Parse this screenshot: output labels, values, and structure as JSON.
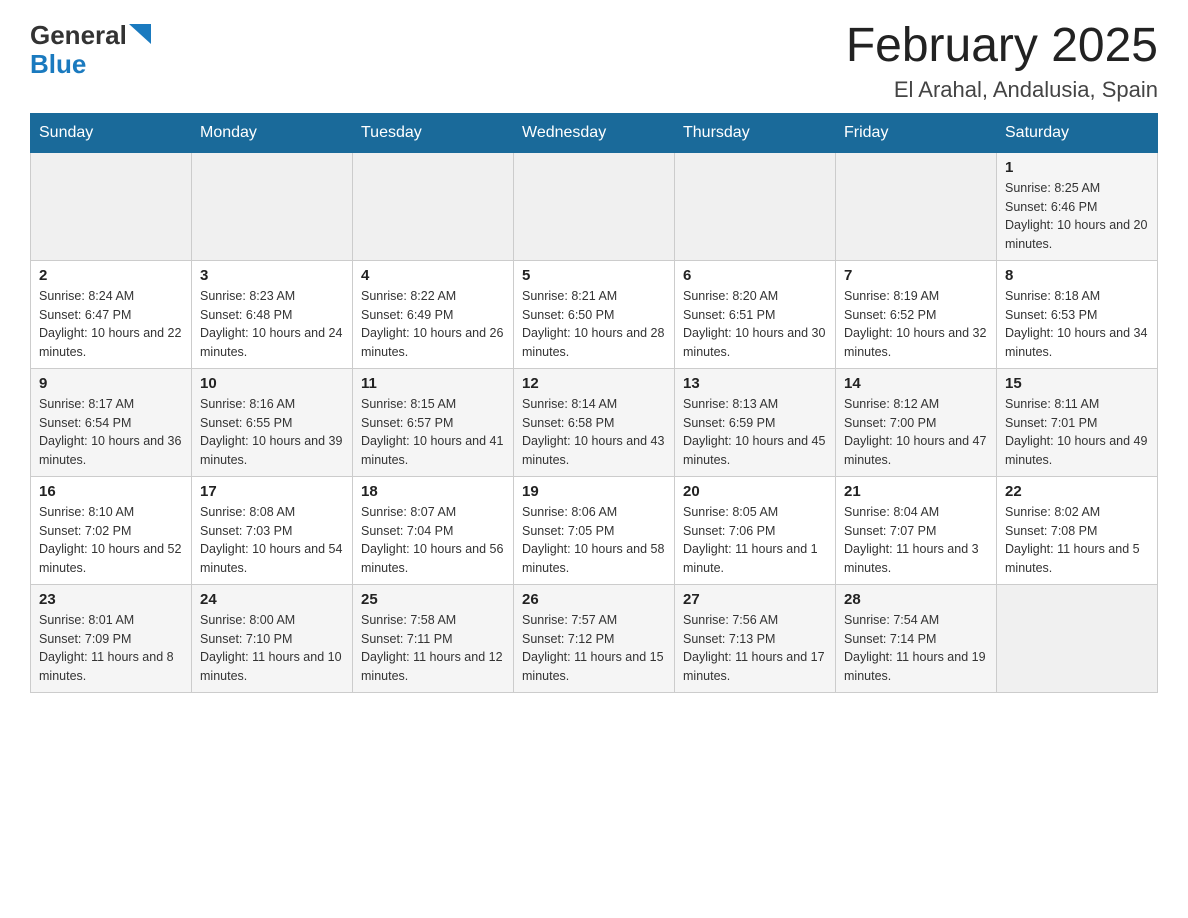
{
  "header": {
    "logo_general": "General",
    "logo_blue": "Blue",
    "month_title": "February 2025",
    "location": "El Arahal, Andalusia, Spain"
  },
  "weekdays": [
    "Sunday",
    "Monday",
    "Tuesday",
    "Wednesday",
    "Thursday",
    "Friday",
    "Saturday"
  ],
  "weeks": [
    {
      "row_class": "row-odd",
      "days": [
        {
          "number": "",
          "info": "",
          "empty": true
        },
        {
          "number": "",
          "info": "",
          "empty": true
        },
        {
          "number": "",
          "info": "",
          "empty": true
        },
        {
          "number": "",
          "info": "",
          "empty": true
        },
        {
          "number": "",
          "info": "",
          "empty": true
        },
        {
          "number": "",
          "info": "",
          "empty": true
        },
        {
          "number": "1",
          "info": "Sunrise: 8:25 AM\nSunset: 6:46 PM\nDaylight: 10 hours and 20 minutes.",
          "empty": false
        }
      ]
    },
    {
      "row_class": "row-even",
      "days": [
        {
          "number": "2",
          "info": "Sunrise: 8:24 AM\nSunset: 6:47 PM\nDaylight: 10 hours and 22 minutes.",
          "empty": false
        },
        {
          "number": "3",
          "info": "Sunrise: 8:23 AM\nSunset: 6:48 PM\nDaylight: 10 hours and 24 minutes.",
          "empty": false
        },
        {
          "number": "4",
          "info": "Sunrise: 8:22 AM\nSunset: 6:49 PM\nDaylight: 10 hours and 26 minutes.",
          "empty": false
        },
        {
          "number": "5",
          "info": "Sunrise: 8:21 AM\nSunset: 6:50 PM\nDaylight: 10 hours and 28 minutes.",
          "empty": false
        },
        {
          "number": "6",
          "info": "Sunrise: 8:20 AM\nSunset: 6:51 PM\nDaylight: 10 hours and 30 minutes.",
          "empty": false
        },
        {
          "number": "7",
          "info": "Sunrise: 8:19 AM\nSunset: 6:52 PM\nDaylight: 10 hours and 32 minutes.",
          "empty": false
        },
        {
          "number": "8",
          "info": "Sunrise: 8:18 AM\nSunset: 6:53 PM\nDaylight: 10 hours and 34 minutes.",
          "empty": false
        }
      ]
    },
    {
      "row_class": "row-odd",
      "days": [
        {
          "number": "9",
          "info": "Sunrise: 8:17 AM\nSunset: 6:54 PM\nDaylight: 10 hours and 36 minutes.",
          "empty": false
        },
        {
          "number": "10",
          "info": "Sunrise: 8:16 AM\nSunset: 6:55 PM\nDaylight: 10 hours and 39 minutes.",
          "empty": false
        },
        {
          "number": "11",
          "info": "Sunrise: 8:15 AM\nSunset: 6:57 PM\nDaylight: 10 hours and 41 minutes.",
          "empty": false
        },
        {
          "number": "12",
          "info": "Sunrise: 8:14 AM\nSunset: 6:58 PM\nDaylight: 10 hours and 43 minutes.",
          "empty": false
        },
        {
          "number": "13",
          "info": "Sunrise: 8:13 AM\nSunset: 6:59 PM\nDaylight: 10 hours and 45 minutes.",
          "empty": false
        },
        {
          "number": "14",
          "info": "Sunrise: 8:12 AM\nSunset: 7:00 PM\nDaylight: 10 hours and 47 minutes.",
          "empty": false
        },
        {
          "number": "15",
          "info": "Sunrise: 8:11 AM\nSunset: 7:01 PM\nDaylight: 10 hours and 49 minutes.",
          "empty": false
        }
      ]
    },
    {
      "row_class": "row-even",
      "days": [
        {
          "number": "16",
          "info": "Sunrise: 8:10 AM\nSunset: 7:02 PM\nDaylight: 10 hours and 52 minutes.",
          "empty": false
        },
        {
          "number": "17",
          "info": "Sunrise: 8:08 AM\nSunset: 7:03 PM\nDaylight: 10 hours and 54 minutes.",
          "empty": false
        },
        {
          "number": "18",
          "info": "Sunrise: 8:07 AM\nSunset: 7:04 PM\nDaylight: 10 hours and 56 minutes.",
          "empty": false
        },
        {
          "number": "19",
          "info": "Sunrise: 8:06 AM\nSunset: 7:05 PM\nDaylight: 10 hours and 58 minutes.",
          "empty": false
        },
        {
          "number": "20",
          "info": "Sunrise: 8:05 AM\nSunset: 7:06 PM\nDaylight: 11 hours and 1 minute.",
          "empty": false
        },
        {
          "number": "21",
          "info": "Sunrise: 8:04 AM\nSunset: 7:07 PM\nDaylight: 11 hours and 3 minutes.",
          "empty": false
        },
        {
          "number": "22",
          "info": "Sunrise: 8:02 AM\nSunset: 7:08 PM\nDaylight: 11 hours and 5 minutes.",
          "empty": false
        }
      ]
    },
    {
      "row_class": "row-odd",
      "days": [
        {
          "number": "23",
          "info": "Sunrise: 8:01 AM\nSunset: 7:09 PM\nDaylight: 11 hours and 8 minutes.",
          "empty": false
        },
        {
          "number": "24",
          "info": "Sunrise: 8:00 AM\nSunset: 7:10 PM\nDaylight: 11 hours and 10 minutes.",
          "empty": false
        },
        {
          "number": "25",
          "info": "Sunrise: 7:58 AM\nSunset: 7:11 PM\nDaylight: 11 hours and 12 minutes.",
          "empty": false
        },
        {
          "number": "26",
          "info": "Sunrise: 7:57 AM\nSunset: 7:12 PM\nDaylight: 11 hours and 15 minutes.",
          "empty": false
        },
        {
          "number": "27",
          "info": "Sunrise: 7:56 AM\nSunset: 7:13 PM\nDaylight: 11 hours and 17 minutes.",
          "empty": false
        },
        {
          "number": "28",
          "info": "Sunrise: 7:54 AM\nSunset: 7:14 PM\nDaylight: 11 hours and 19 minutes.",
          "empty": false
        },
        {
          "number": "",
          "info": "",
          "empty": true
        }
      ]
    }
  ]
}
